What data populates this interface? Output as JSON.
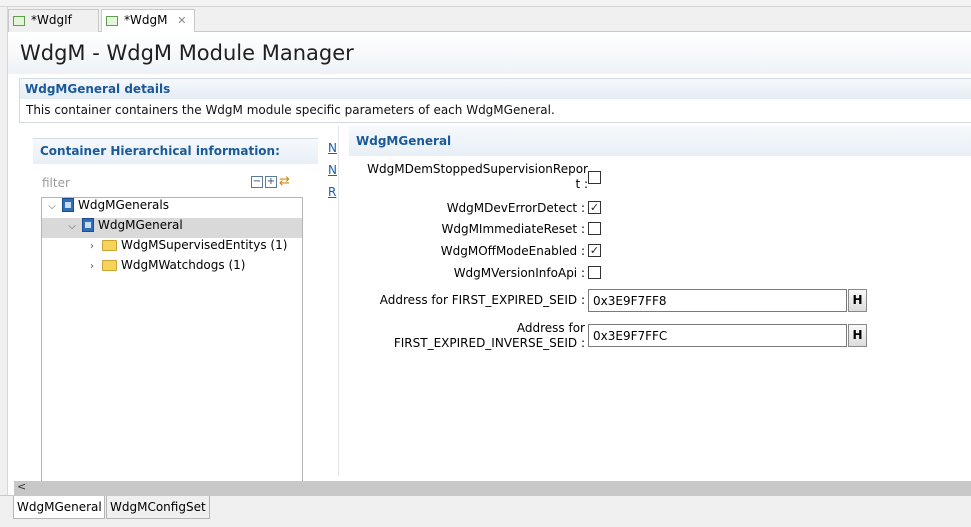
{
  "editor_tabs": [
    {
      "label": "*WdgIf"
    },
    {
      "label": "*WdgM",
      "close": "✕"
    }
  ],
  "page": {
    "title": "WdgM - WdgM Module Manager"
  },
  "details": {
    "title": "WdgMGeneral details",
    "description": "This container containers the WdgM module specific parameters of each WdgMGeneral."
  },
  "left_panel": {
    "title": "Container Hierarchical information:",
    "filter_placeholder": "filter",
    "tree": [
      {
        "label": "WdgMGenerals",
        "arrow": "⌵"
      },
      {
        "label": "WdgMGeneral",
        "arrow": "⌵"
      },
      {
        "label": "WdgMSupervisedEntitys (1)",
        "arrow": "›"
      },
      {
        "label": "WdgMWatchdogs (1)",
        "arrow": "›"
      }
    ]
  },
  "side_links": [
    "N",
    "N",
    "R"
  ],
  "right_panel": {
    "title": "WdgMGeneral",
    "params": [
      {
        "label_line1": "WdgMDemStoppedSupervisionRepor",
        "label_line2": "t :",
        "checked": false
      },
      {
        "label": "WdgMDevErrorDetect :",
        "checked": true
      },
      {
        "label": "WdgMImmediateReset :",
        "checked": false
      },
      {
        "label": "WdgMOffModeEnabled :",
        "checked": true
      },
      {
        "label": "WdgMVersionInfoApi :",
        "checked": false
      }
    ],
    "fields": [
      {
        "label": "Address for FIRST_EXPIRED_SEID :",
        "value": "0x3E9F7FF8",
        "button": "H"
      },
      {
        "label_line1": "Address for",
        "label_line2": "FIRST_EXPIRED_INVERSE_SEID :",
        "value": "0x3E9F7FFC",
        "button": "H"
      }
    ]
  },
  "scrollbar": {
    "left_arrow": "<"
  },
  "page_tabs": [
    {
      "label": "WdgMGeneral"
    },
    {
      "label": "WdgMConfigSet"
    }
  ],
  "check_mark": "✓"
}
